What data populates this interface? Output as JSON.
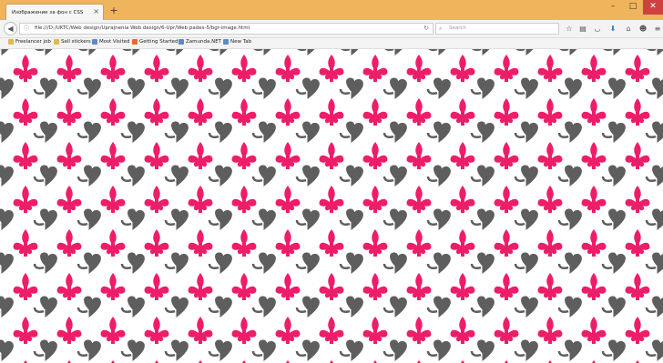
{
  "tab": {
    "title": "Изображение за фон с CSS",
    "close": "×"
  },
  "newtab_label": "+",
  "window_controls": {
    "minimize": "–",
    "maximize": "□",
    "close": "✕"
  },
  "url": "file:///D:/UKTC/Web design/Uprajnenia Web design/6-Upr/Web pades-5/bgr-image.html",
  "search_placeholder": "Search",
  "bookmarks": [
    {
      "label": "Freelancer job",
      "icon": "folder-icon"
    },
    {
      "label": "Sell stickers",
      "icon": "folder-icon"
    },
    {
      "label": "Most Visited",
      "icon": "globe-icon"
    },
    {
      "label": "Getting Started",
      "icon": "firefox-icon"
    },
    {
      "label": "Zamunda.NET",
      "icon": "globe-icon"
    },
    {
      "label": "New Tab",
      "icon": "globe-icon"
    }
  ],
  "colors": {
    "titlebar": "#f0b45c",
    "fleur": "#ee1d6a",
    "shape": "#5e5e5e",
    "page_bg": "#ffffff"
  },
  "pattern": {
    "fleur_icon": "fleur-de-lis-icon",
    "gray_icon": "heart-swirl-icon"
  }
}
